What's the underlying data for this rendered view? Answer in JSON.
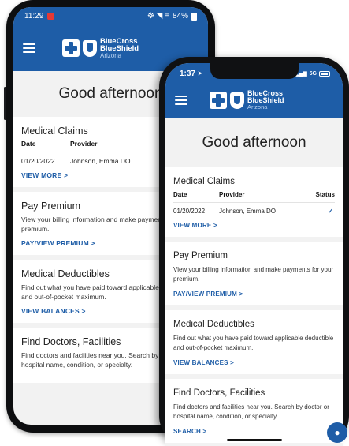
{
  "brand": {
    "line1": "BlueCross",
    "line2": "BlueShield",
    "line3": "Arizona"
  },
  "android": {
    "status": {
      "time": "11:29",
      "signal": "☸ ◥ ≡",
      "battery": "84%"
    },
    "greeting": "Good afternoon",
    "claims": {
      "title": "Medical Claims",
      "col_date": "Date",
      "col_provider": "Provider",
      "row_date": "01/20/2022",
      "row_provider": "Johnson, Emma DO",
      "link": "VIEW MORE"
    },
    "premium": {
      "title": "Pay Premium",
      "body": "View your billing information and make payments for your premium.",
      "link": "PAY/VIEW PREMIUM"
    },
    "deductibles": {
      "title": "Medical Deductibles",
      "body": "Find out what you have paid toward applicable deductible and out-of-pocket maximum.",
      "link": "VIEW BALANCES"
    },
    "doctors": {
      "title": "Find Doctors, Facilities",
      "body": "Find doctors and facilities near you. Search by doctor or hospital name, condition, or specialty."
    }
  },
  "iphone": {
    "status": {
      "time": "1:37",
      "network": "5G"
    },
    "greeting": "Good afternoon",
    "claims": {
      "title": "Medical Claims",
      "col_date": "Date",
      "col_provider": "Provider",
      "col_status": "Status",
      "row_date": "01/20/2022",
      "row_provider": "Johnson, Emma DO",
      "row_status_icon": "checkmark-icon",
      "link": "VIEW MORE"
    },
    "premium": {
      "title": "Pay Premium",
      "body": "View your billing information and make payments for your premium.",
      "link": "PAY/VIEW PREMIUM"
    },
    "deductibles": {
      "title": "Medical Deductibles",
      "body": "Find out what you have paid toward applicable deductible and out-of-pocket maximum.",
      "link": "VIEW BALANCES"
    },
    "doctors": {
      "title": "Find Doctors, Facilities",
      "body": "Find doctors and facilities near you. Search by doctor or hospital name, condition, or specialty.",
      "link": "SEARCH"
    }
  },
  "colors": {
    "brand_blue": "#1e5da7",
    "background": "#f2f2f2"
  }
}
